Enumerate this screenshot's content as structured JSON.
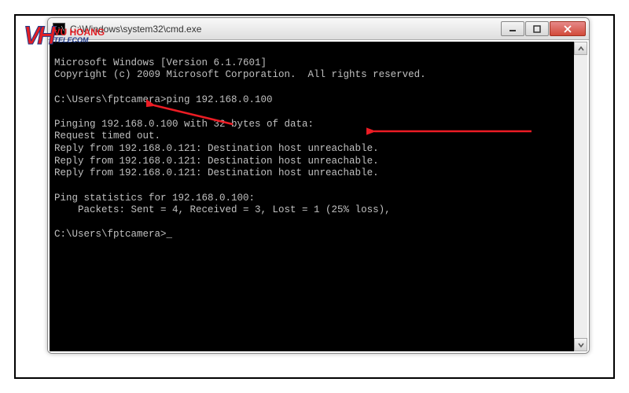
{
  "logo": {
    "glyph": "VH",
    "brand_top": "VU HOANG",
    "brand_bottom": "TELECOM"
  },
  "window": {
    "title_icon": "C:\\",
    "title": "C:\\Windows\\system32\\cmd.exe"
  },
  "terminal": {
    "lines": [
      "Microsoft Windows [Version 6.1.7601]",
      "Copyright (c) 2009 Microsoft Corporation.  All rights reserved.",
      "",
      "C:\\Users\\fptcamera>ping 192.168.0.100",
      "",
      "Pinging 192.168.0.100 with 32 bytes of data:",
      "Request timed out.",
      "Reply from 192.168.0.121: Destination host unreachable.",
      "Reply from 192.168.0.121: Destination host unreachable.",
      "Reply from 192.168.0.121: Destination host unreachable.",
      "",
      "Ping statistics for 192.168.0.100:",
      "    Packets: Sent = 4, Received = 3, Lost = 1 (25% loss),",
      "",
      "C:\\Users\\fptcamera>_"
    ]
  }
}
